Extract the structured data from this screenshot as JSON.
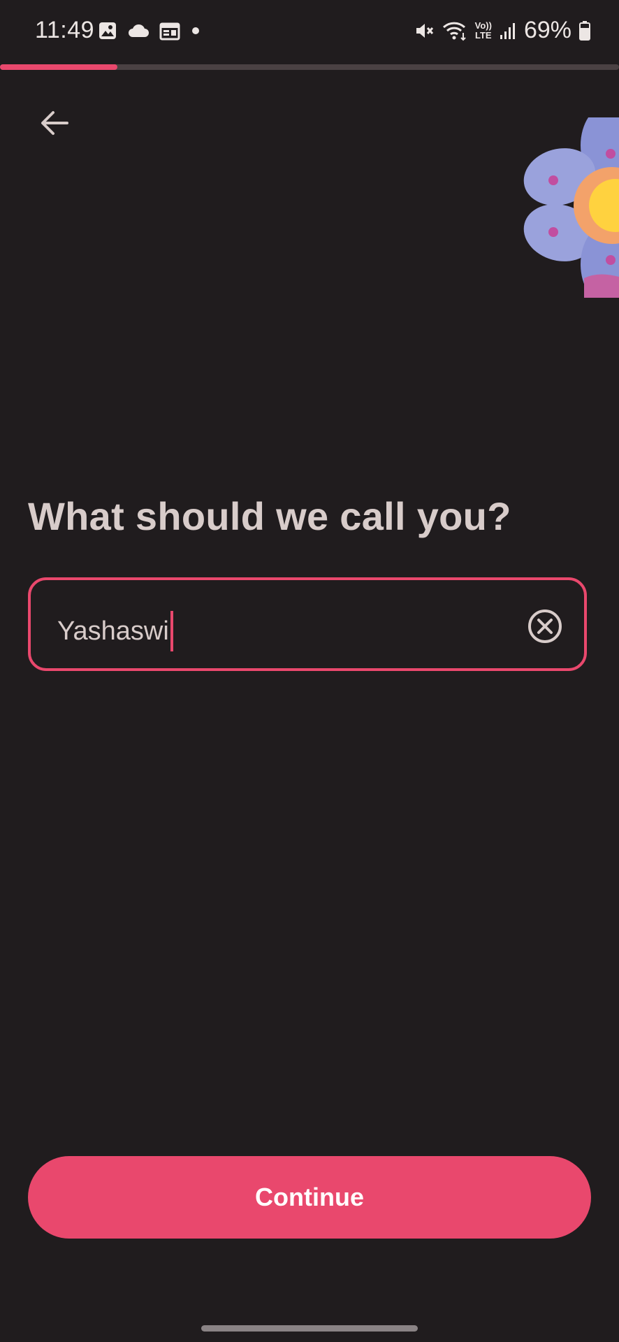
{
  "status_bar": {
    "time": "11:49",
    "battery_text": "69%",
    "left_icons": [
      "image-icon",
      "cloud-icon",
      "calendar-icon",
      "dot-icon"
    ],
    "right_icons": [
      "mute-icon",
      "wifi-icon",
      "volte-icon",
      "signal-icon",
      "battery-icon"
    ],
    "volte_label_top": "Vo))",
    "volte_label_bottom": "LTE"
  },
  "progress": {
    "fraction": 0.19,
    "color": "#e9486d"
  },
  "header": {
    "back_icon": "arrow-left-icon"
  },
  "decoration": {
    "name": "flower-illustration"
  },
  "main": {
    "title": "What should we call you?",
    "name_input": {
      "value": "Yashaswi",
      "clear_icon": "clear-circle-icon"
    }
  },
  "footer": {
    "continue_label": "Continue"
  },
  "colors": {
    "accent": "#e9486d",
    "background": "#201c1e",
    "text": "#d8ccca"
  }
}
